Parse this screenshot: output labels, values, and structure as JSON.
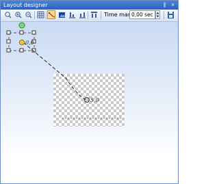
{
  "window": {
    "title": "Layout designer",
    "controls": {
      "pin_icon": "pin-icon",
      "pin_glyph": "‖",
      "close_icon": "close-icon",
      "close_glyph": "×"
    }
  },
  "toolbar": {
    "tools": [
      {
        "name": "zoom-fit-icon",
        "active": false
      },
      {
        "name": "zoom-in-icon",
        "active": false
      },
      {
        "name": "zoom-out-icon",
        "active": false
      },
      {
        "name": "grid-icon",
        "active": false
      },
      {
        "name": "motion-path-icon",
        "active": true
      },
      {
        "name": "image-icon",
        "active": false
      },
      {
        "name": "align-icon",
        "active": false
      },
      {
        "name": "distribute-icon",
        "active": false
      },
      {
        "name": "columns-icon",
        "active": false
      },
      {
        "name": "save-icon",
        "active": false
      }
    ],
    "time_mark_label": "Time mark:",
    "time_mark_value": "0,00 sec"
  },
  "canvas": {
    "start_label": "0,0",
    "end_label": "5,0",
    "colors": {
      "start_point": "#f5c242",
      "end_point": "#7ed67a",
      "selection_outline": "#555555",
      "checker_dark": "#c8c8c8"
    }
  }
}
